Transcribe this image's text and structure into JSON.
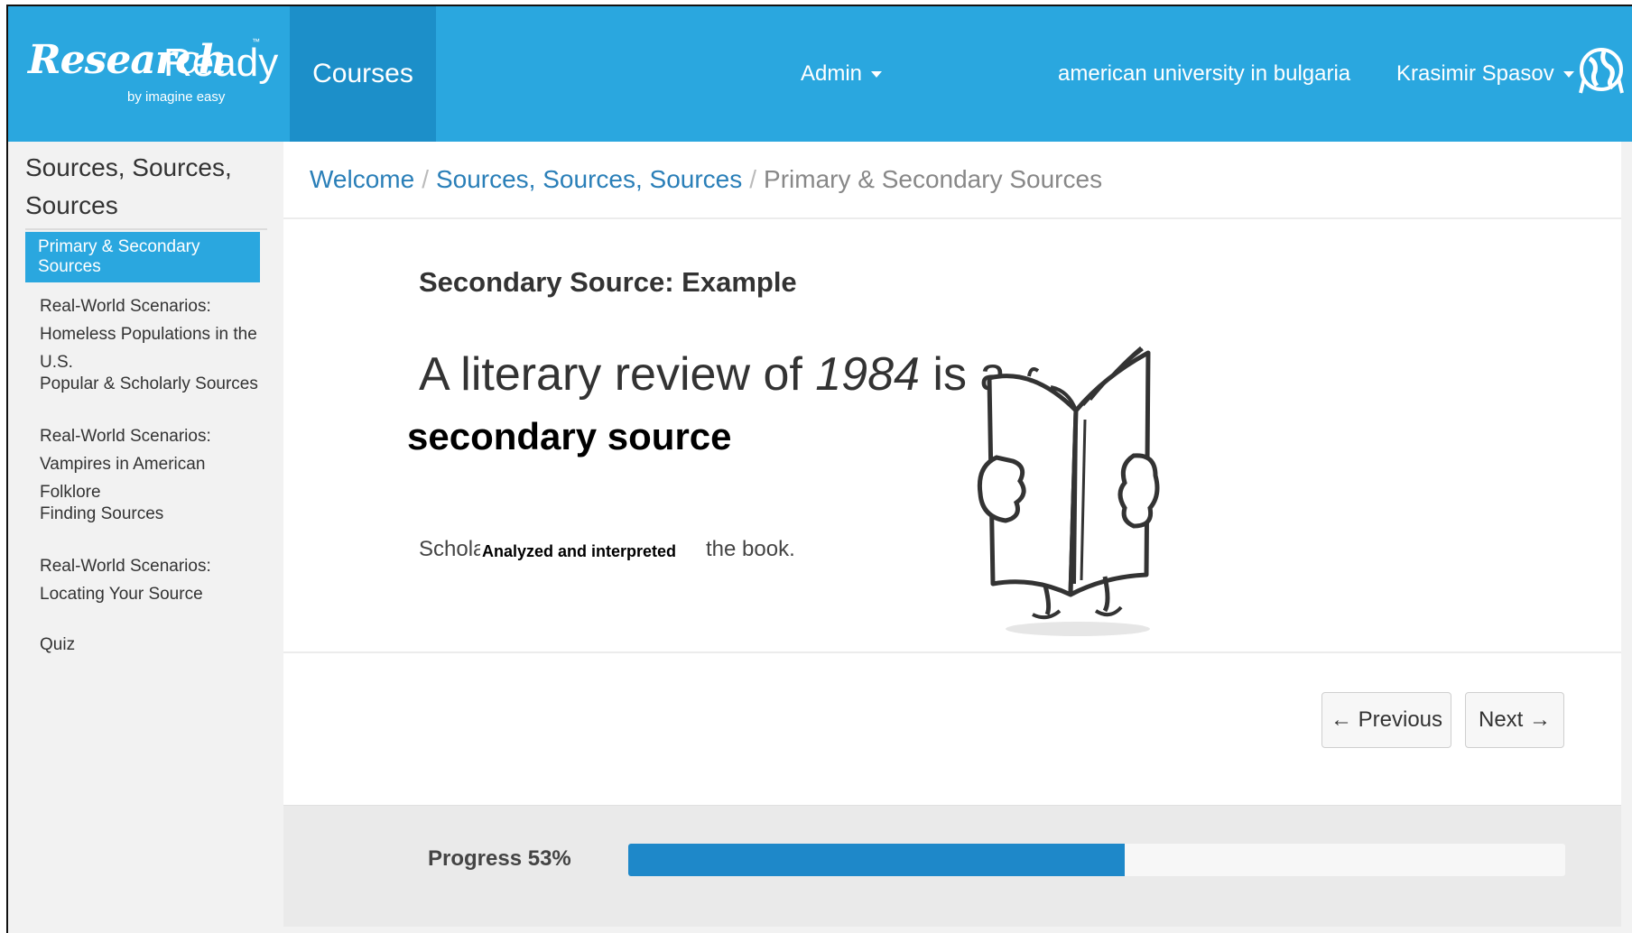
{
  "brand": {
    "logo_script": "Research",
    "logo_word": "Ready",
    "logo_tm": "™",
    "logo_by": "by imagine easy"
  },
  "navbar": {
    "courses_label": "Courses",
    "admin_label": "Admin",
    "institution": "american university in bulgaria",
    "user_name": "Krasimir Spasov",
    "avatar_icon": "globe-icon"
  },
  "sidebar": {
    "title": "Sources, Sources, Sources",
    "active_item": "Primary & Secondary Sources",
    "items": [
      "Real-World Scenarios: Homeless Populations in the U.S.",
      "Popular & Scholarly Sources",
      "Real-World Scenarios: Vampires in American Folklore",
      "Finding Sources",
      "Real-World Scenarios: Locating Your Source",
      "Quiz"
    ]
  },
  "breadcrumb": {
    "items": [
      "Welcome",
      "Sources, Sources, Sources",
      "Primary & Secondary Sources"
    ],
    "separator": "/"
  },
  "content": {
    "heading": "Secondary Source: Example",
    "line1_prefix": "A literary review of ",
    "line1_italic": "1984",
    "line1_suffix": " is a",
    "line2": "secondary source",
    "scholars": "Scholars",
    "overlay": "Analyzed and interpreted",
    "the_book": "the book.",
    "illustration_icon": "reading-book-icon"
  },
  "buttons": {
    "previous": "← Previous",
    "next": "Next →"
  },
  "progress": {
    "label": "Progress 53%",
    "value_percent": 53,
    "color": "#1e88c9"
  },
  "colors": {
    "primary": "#2aa7df",
    "primary_dark": "#1c8fc9",
    "link": "#2a7fb8"
  }
}
